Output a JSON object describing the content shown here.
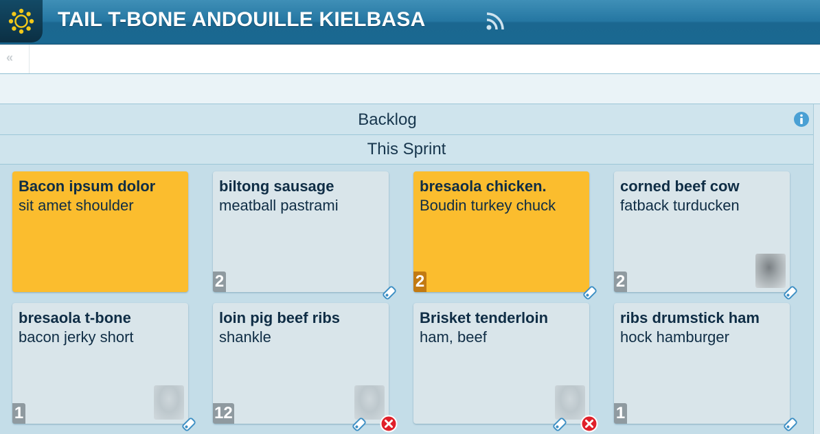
{
  "app": {
    "title": "TAIL T-BONE ANDOUILLE KIELBASA",
    "logo_icon": "gear-logo-icon",
    "feed_icon": "rss-icon",
    "collapse_icon": "double-chevron-left-icon"
  },
  "toolbar": {
    "collapse_label": "«"
  },
  "rows": {
    "backlog": "Backlog",
    "sprint": "This Sprint"
  },
  "colors": {
    "header": "#2577a2",
    "card_default": "#d9e5ea",
    "card_highlight": "#fbbd2e",
    "block_icon": "#e0202a"
  },
  "cards": [
    {
      "title": "Bacon ipsum dolor",
      "desc": "sit amet shoulder",
      "points": "",
      "highlight": true
    },
    {
      "title": "biltong sausage",
      "desc": "meatball pastrami",
      "points": "2",
      "highlight": false,
      "tag": true
    },
    {
      "title": "bresaola chicken.",
      "desc": "Boudin turkey chuck",
      "points": "2",
      "highlight": true,
      "tag": true
    },
    {
      "title": "corned beef cow",
      "desc": "fatback turducken",
      "points": "2",
      "highlight": false,
      "tag": true,
      "avatar": true
    },
    {
      "title": "bresaola t-bone",
      "desc": "bacon jerky short",
      "points": "1",
      "highlight": false,
      "tag": true,
      "avatar": true
    },
    {
      "title": "loin pig beef ribs",
      "desc": "shankle",
      "points": "12",
      "highlight": false,
      "tag": true,
      "avatar": true,
      "blocked": true
    },
    {
      "title": "Brisket tenderloin",
      "desc": "ham, beef",
      "points": "",
      "highlight": false,
      "tag": true,
      "avatar": true,
      "blocked": true
    },
    {
      "title": "ribs drumstick ham",
      "desc": "hock hamburger",
      "points": "1",
      "highlight": false,
      "tag": true
    }
  ]
}
